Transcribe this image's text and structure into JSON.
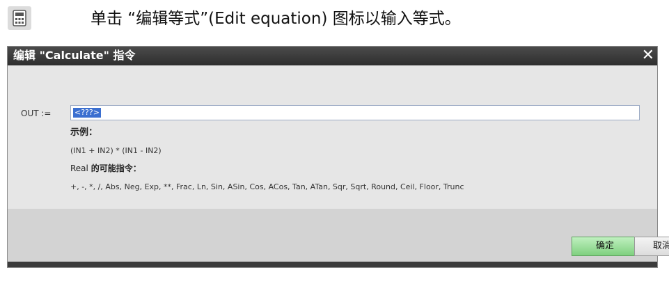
{
  "instruction": {
    "icon": "calculator-icon",
    "text": "单击 “编辑等式”(Edit equation) 图标以输入等式。"
  },
  "dialog": {
    "title": "编辑 \"Calculate\" 指令",
    "close_icon": "close-icon",
    "out_label": "OUT :=",
    "out_value": "<???>",
    "example_title": "示例：",
    "example_expression": "(IN1 + IN2) * (IN1 - IN2)",
    "instructions_prefix": "Real",
    "instructions_title": "的可能指令：",
    "instructions_list": "+, -, *, /, Abs, Neg, Exp, **, Frac, Ln, Sin, ASin, Cos, ACos, Tan, ATan, Sqr, Sqrt, Round, Ceil, Floor, Trunc",
    "ok_label": "确定",
    "cancel_label": "取消"
  },
  "colors": {
    "titlebar": "#3a3a3a",
    "ok_button": "#8fd88f",
    "selection": "#3b6fd0"
  }
}
